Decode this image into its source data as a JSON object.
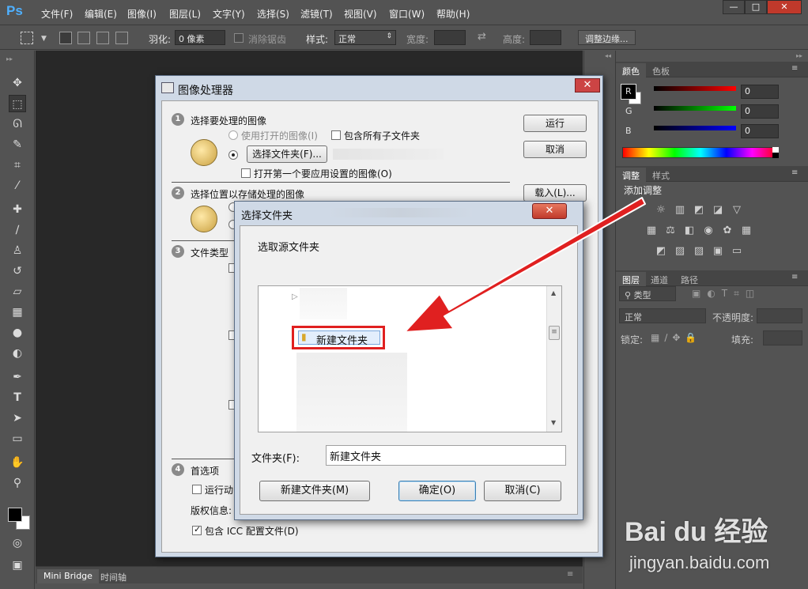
{
  "app": {
    "logo": "Ps",
    "menu": [
      "文件(F)",
      "编辑(E)",
      "图像(I)",
      "图层(L)",
      "文字(Y)",
      "选择(S)",
      "滤镜(T)",
      "视图(V)",
      "窗口(W)",
      "帮助(H)"
    ],
    "window_buttons": {
      "minimize": "—",
      "maximize": "□",
      "close": "✕"
    }
  },
  "options_bar": {
    "feather_label": "羽化:",
    "feather_value": "0 像素",
    "antialias_label": "消除锯齿",
    "style_label": "样式:",
    "style_value": "正常",
    "width_label": "宽度:",
    "height_label": "高度:",
    "refine_edge": "调整边缘..."
  },
  "bottom_tabs": [
    "Mini Bridge",
    "时间轴"
  ],
  "color_panel": {
    "tabs": [
      "颜色",
      "色板"
    ],
    "channels": [
      {
        "label": "R",
        "value": "0"
      },
      {
        "label": "G",
        "value": "0"
      },
      {
        "label": "B",
        "value": "0"
      }
    ]
  },
  "adjust_panel": {
    "tabs": [
      "调整",
      "样式"
    ],
    "add_label": "添加调整"
  },
  "layers_panel": {
    "tabs": [
      "图层",
      "通道",
      "路径"
    ],
    "kind_label": "类型",
    "blend_mode": "正常",
    "opacity_label": "不透明度:",
    "lock_label": "锁定:",
    "fill_label": "填充:"
  },
  "image_processor": {
    "title": "图像处理器",
    "close": "✕",
    "section1": {
      "num": "1",
      "title": "选择要处理的图像",
      "use_open": "使用打开的图像(I)",
      "include_sub": "包含所有子文件夹",
      "choose_folder": "选择文件夹(F)...",
      "open_first": "打开第一个要应用设置的图像(O)"
    },
    "section2": {
      "num": "2",
      "title": "选择位置以存储处理的图像"
    },
    "section3": {
      "num": "3",
      "title": "文件类型"
    },
    "section4": {
      "num": "4",
      "title": "首选项",
      "run_action": "运行动",
      "copyright": "版权信息:",
      "include_icc": "包含 ICC 配置文件(D)"
    },
    "buttons": {
      "run": "运行",
      "cancel": "取消",
      "load": "载入(L)..."
    }
  },
  "browse_dialog": {
    "title": "选择文件夹",
    "close": "✕",
    "prompt": "选取源文件夹",
    "tree_item": "新建文件夹",
    "folder_label": "文件夹(F):",
    "folder_value": "新建文件夹",
    "buttons": {
      "new_folder": "新建文件夹(M)",
      "ok": "确定(O)",
      "cancel": "取消(C)"
    }
  },
  "watermark": {
    "brand": "Bai du 经验",
    "url": "jingyan.baidu.com"
  },
  "colors": {
    "accent_red": "#e02020",
    "ps_bg": "#535353",
    "canvas": "#282828"
  }
}
